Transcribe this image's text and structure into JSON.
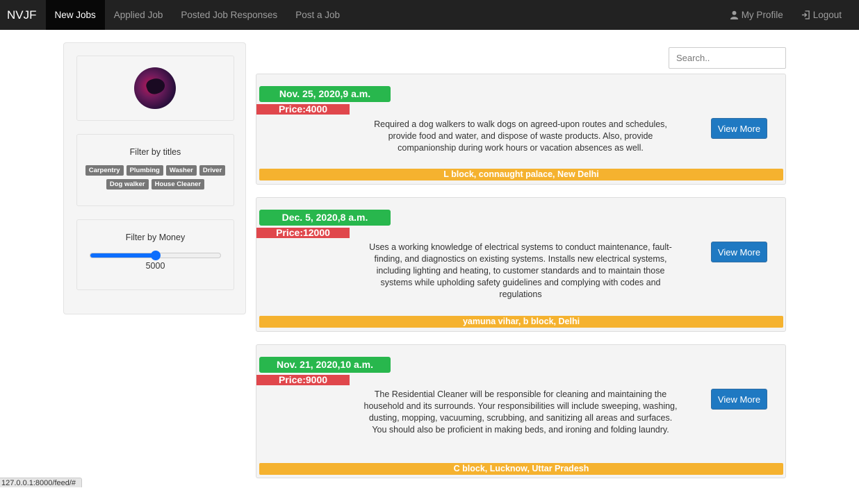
{
  "nav": {
    "brand": "NVJF",
    "links": [
      "New Jobs",
      "Applied Job",
      "Posted Job Responses",
      "Post a Job"
    ],
    "profile": "My Profile",
    "logout": "Logout"
  },
  "sidebar": {
    "title_filter_label": "Filter by titles",
    "tags": [
      "Carpentry",
      "Plumbing",
      "Washer",
      "Driver",
      "Dog walker",
      "House Cleaner"
    ],
    "money_filter_label": "Filter by Money",
    "money_value": "5000",
    "money_slider_fraction": 0.5
  },
  "search": {
    "placeholder": "Search.."
  },
  "jobs": [
    {
      "date": "Nov. 25, 2020,9 a.m.",
      "price": "Price:4000",
      "description": "Required a dog walkers to walk dogs on agreed-upon routes and schedules, provide food and water, and dispose of waste products. Also, provide companionship during work hours or vacation absences as well.",
      "button": "View More",
      "location": "L block, connaught palace, New Delhi"
    },
    {
      "date": "Dec. 5, 2020,8 a.m.",
      "price": "Price:12000",
      "description": "Uses a working knowledge of electrical systems to conduct maintenance, fault-finding, and diagnostics on existing systems. Installs new electrical systems, including lighting and heating, to customer standards and to maintain those systems while upholding safety guidelines and complying with codes and regulations",
      "button": "View More",
      "location": "yamuna vihar, b block, Delhi"
    },
    {
      "date": "Nov. 21, 2020,10 a.m.",
      "price": "Price:9000",
      "description": "The Residential Cleaner will be responsible for cleaning and maintaining the household and its surrounds. Your responsibilities will include sweeping, washing, dusting, mopping, vacuuming, scrubbing, and sanitizing all areas and surfaces. You should also be proficient in making beds, and ironing and folding laundry.",
      "button": "View More",
      "location": "C block, Lucknow, Uttar Pradesh"
    }
  ],
  "status_url": "127.0.0.1:8000/feed/#"
}
